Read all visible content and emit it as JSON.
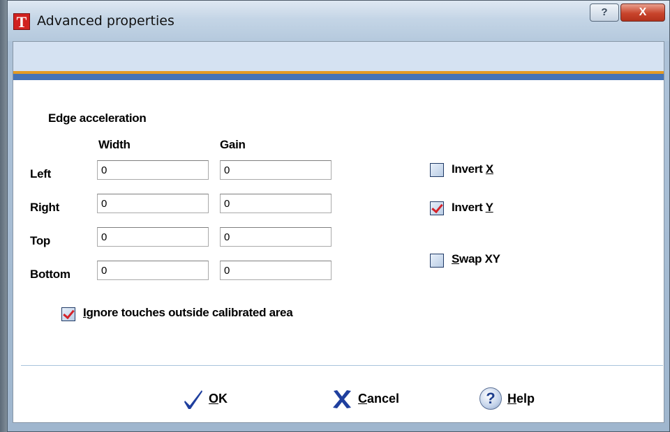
{
  "window": {
    "title": "Advanced properties",
    "app_icon_letter": "T",
    "help_glyph": "?",
    "close_glyph": "X"
  },
  "edge_acceleration": {
    "section_title": "Edge acceleration",
    "col_width": "Width",
    "col_gain": "Gain",
    "rows": [
      {
        "label": "Left",
        "width": "0",
        "gain": "0"
      },
      {
        "label": "Right",
        "width": "0",
        "gain": "0"
      },
      {
        "label": "Top",
        "width": "0",
        "gain": "0"
      },
      {
        "label": "Bottom",
        "width": "0",
        "gain": "0"
      }
    ]
  },
  "options": {
    "invert_x": {
      "prefix": "Invert ",
      "accel": "X",
      "suffix": "",
      "checked": false
    },
    "invert_y": {
      "prefix": "Invert ",
      "accel": "Y",
      "suffix": "",
      "checked": true
    },
    "swap_xy": {
      "prefix": "",
      "accel": "S",
      "suffix": "wap XY",
      "checked": false
    },
    "ignore_touches": {
      "prefix": "",
      "accel": "I",
      "suffix": "gnore touches outside calibrated area",
      "checked": true
    }
  },
  "buttons": {
    "ok": {
      "accel": "O",
      "rest": "K",
      "icon": "checkmark-icon"
    },
    "cancel": {
      "accel": "C",
      "rest": "ancel",
      "icon": "cross-icon"
    },
    "help": {
      "accel": "H",
      "rest": "elp",
      "icon": "question-icon",
      "glyph": "?"
    }
  },
  "colors": {
    "accent_orange": "#e49b23",
    "accent_blue": "#4674b6",
    "check_red": "#d4232a",
    "ok_blue": "#1f3f9e"
  }
}
